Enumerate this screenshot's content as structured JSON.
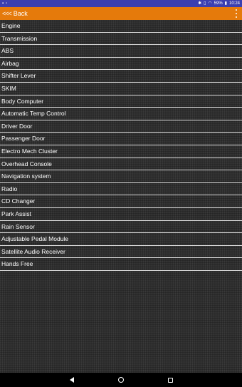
{
  "status_bar": {
    "time": "10:24",
    "battery": "59%",
    "left_icons": [
      "notification-icon",
      "image-icon"
    ],
    "right_icons": [
      "bluetooth-icon",
      "vibrate-icon",
      "wifi-icon",
      "battery-icon"
    ],
    "color": "#3b3fb0"
  },
  "toolbar": {
    "back_arrow": "<<<",
    "back_label": "Back",
    "color": "#e57a0b"
  },
  "modules": [
    "Engine",
    "Transmission",
    "ABS",
    "Airbag",
    "Shifter Lever",
    "SKIM",
    "Body Computer",
    "Automatic Temp Control",
    "Driver Door",
    "Passenger Door",
    "Electro Mech Cluster",
    "Overhead Console",
    "Navigation system",
    "Radio",
    "CD Changer",
    "Park Assist",
    "Rain Sensor",
    "Adjustable Pedal Module",
    "Satellite Audio Receiver",
    "Hands Free"
  ],
  "nav_bar": {
    "buttons": [
      "back-icon",
      "home-icon",
      "recent-apps-icon"
    ]
  }
}
